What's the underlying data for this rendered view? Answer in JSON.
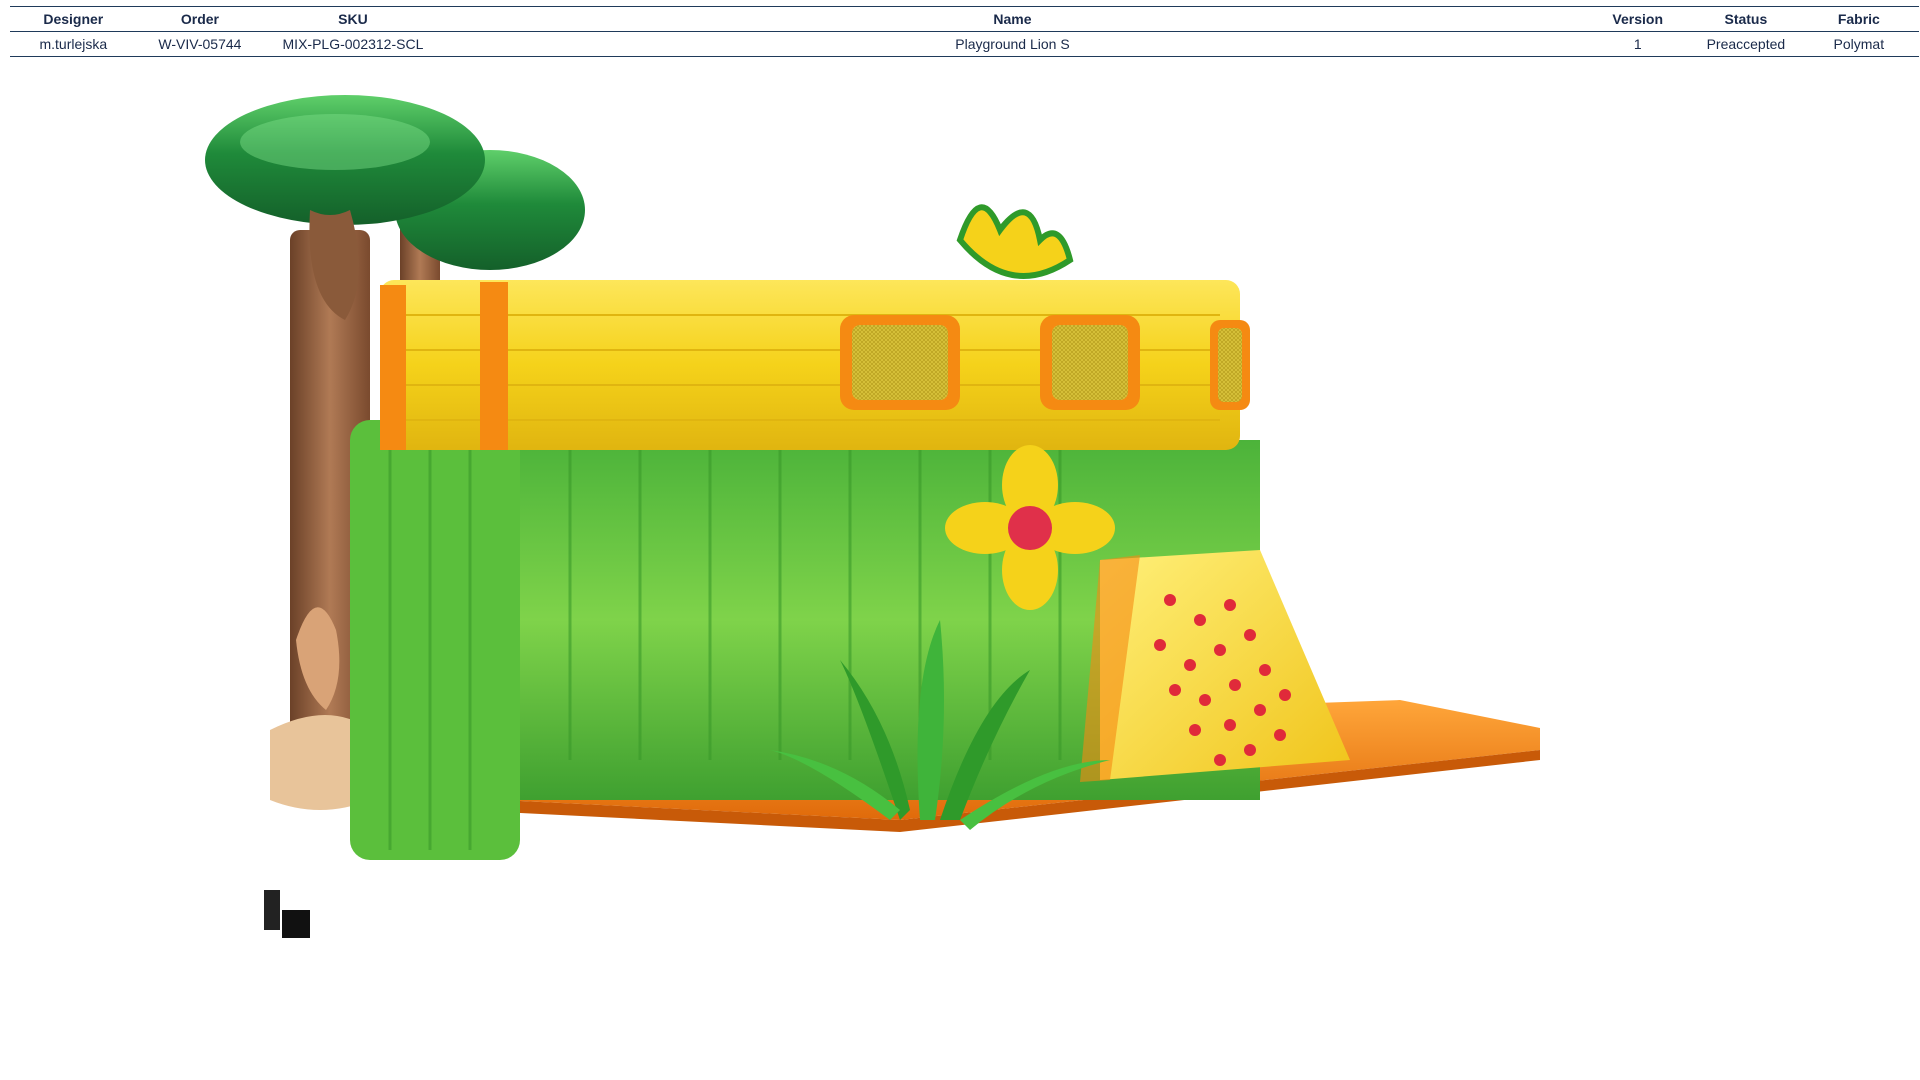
{
  "table": {
    "headers": {
      "designer": "Designer",
      "order": "Order",
      "sku": "SKU",
      "name": "Name",
      "version": "Version",
      "status": "Status",
      "fabric": "Fabric"
    },
    "row": {
      "designer": "m.turlejska",
      "order": "W-VIV-05744",
      "sku": "MIX-PLG-002312-SCL",
      "name": "Playground Lion S",
      "version": "1",
      "status": "Preaccepted",
      "fabric": "Polymat"
    }
  },
  "product_render": {
    "colors": {
      "tree_canopy": "#1f8a3a",
      "tree_trunk": "#8a5a3a",
      "wall_green": "#5cc03a",
      "top_yellow": "#f5d21a",
      "frame_orange": "#f58a12",
      "floor_orange": "#f58a12",
      "climbing_holds": "#e02a3a",
      "flower_center": "#e0304a"
    }
  }
}
